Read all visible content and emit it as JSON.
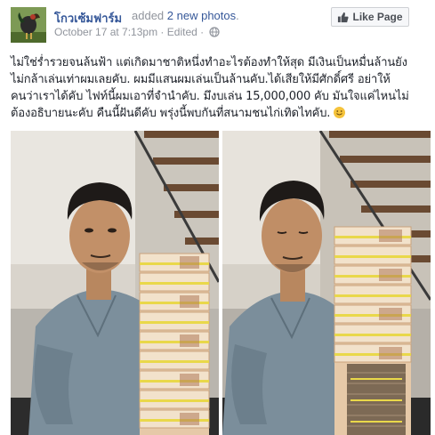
{
  "header": {
    "page_name": "โกวเซ้มฟาร์ม",
    "action_text": "added",
    "photos_link": "2 new photos",
    "timestamp": "October 17 at 7:13pm",
    "separator": "·",
    "edited_label": "Edited",
    "privacy_icon": "globe-icon"
  },
  "like_button": {
    "label": "Like Page",
    "icon": "thumbs-up-icon"
  },
  "post": {
    "lines": [
      "ไม่ใช่ร่ำรวยจนล้นฟ้า แต่เกิดมาชาติหนึ่งทำอะไรต้องทำให้สุด มีเงินเป็นหมื่นล้านยัง",
      "ไม่กล้าเล่นเท่าผมเลยคับ. ผมมีแสนผมเล่นเป็นล้านคับ.ได้เสียให้มีศักดิ์ศรี อย่าให้",
      "คนว่าเราได้คับ ไฟท์นี้ผมเอาที่จำนำคับ. มึงบเล่น 15,000,000 คับ มันใจแค่ไหนไม่",
      "ต้องอธิบายนะคับ คืนนี้ฝันดีคับ พรุ่งนี้พบกันที่สนามชนไก่เทิดไทคับ."
    ],
    "emoji": "smile-emoji"
  },
  "photos": [
    {
      "name": "photo-left",
      "description_icon": "photo"
    },
    {
      "name": "photo-right",
      "description_icon": "photo"
    }
  ],
  "colors": {
    "link": "#365899",
    "meta": "#90949c",
    "text": "#1d2129"
  }
}
